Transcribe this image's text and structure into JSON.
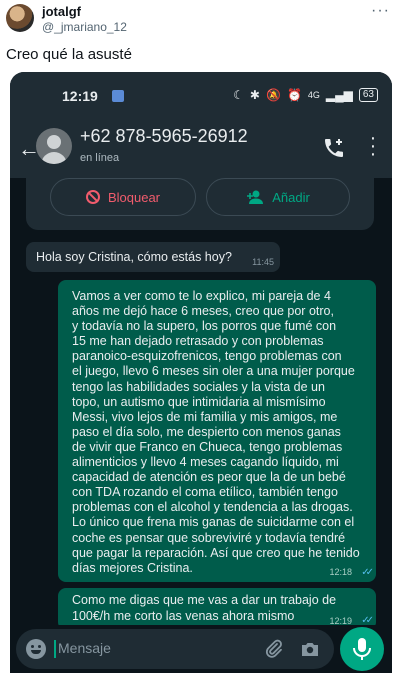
{
  "tweet": {
    "display_name": "jotalgf",
    "handle": "@_jmariano_12",
    "text": "Creo qué la asusté",
    "more_label": "···"
  },
  "status_bar": {
    "time": "12:19",
    "network": "4G",
    "battery": "63"
  },
  "contact": {
    "phone": "+62 878-5965-26912",
    "status": "en línea"
  },
  "actions": {
    "block_label": "Bloquear",
    "add_label": "Añadir"
  },
  "messages": [
    {
      "direction": "in",
      "text": "Hola soy Cristina, cómo estás hoy?",
      "time": "11:45"
    },
    {
      "direction": "out",
      "text": "Vamos a ver como te lo explico, mi pareja de 4\naños me dejó hace 6 meses, creo que por otro,\ny todavía no la supero, los porros que fumé con\n15 me han dejado retrasado y con problemas\nparanoico-esquizofrenicos, tengo problemas con\nel juego, llevo 6 meses sin oler a una mujer porque\ntengo las habilidades sociales y la vista de un\ntopo, un autismo que intimidaria al mismísimo\nMessi, vivo lejos de mi familia y mis amigos, me\npaso el día solo, me despierto con menos ganas\nde vivir que Franco en Chueca, tengo problemas\nalimenticios y llevo 4 meses cagando líquido, mi\ncapacidad de atención es peor que la de un bebé\ncon TDA rozando el coma etílico, también tengo\nproblemas con el alcohol y tendencia a las drogas.\nLo único que frena mis ganas de suicidarme con el\ncoche es pensar que sobreviviré y todavía tendré\nque pagar la reparación. Así que creo que he tenido\ndías mejores Cristina.",
      "time": "12:18"
    },
    {
      "direction": "out",
      "text": "Como me digas que me vas a dar un trabajo de\n100€/h me corto las venas ahora mismo",
      "time": "12:19"
    }
  ],
  "input": {
    "placeholder": "Mensaje"
  },
  "colors": {
    "header": "#1f2c34",
    "background": "#0b141a",
    "outgoing": "#005c4b",
    "accent": "#00a884",
    "danger": "#f15c6d",
    "read_ticks": "#53bdeb"
  }
}
